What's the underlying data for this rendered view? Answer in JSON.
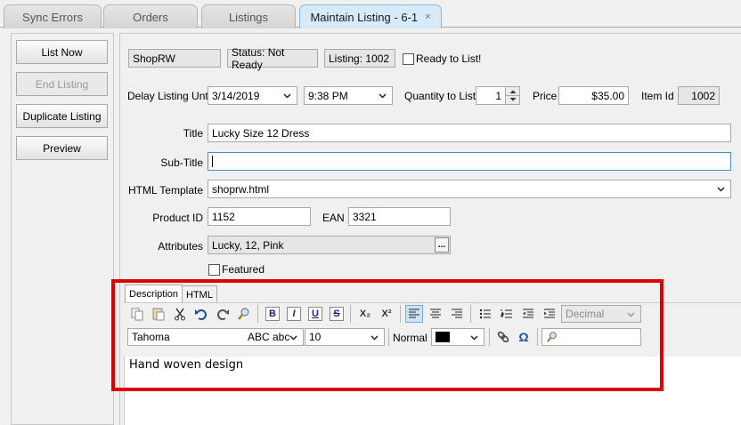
{
  "tabs": [
    {
      "label": "Sync Errors"
    },
    {
      "label": "Orders"
    },
    {
      "label": "Listings"
    },
    {
      "label": "Maintain Listing - 6-1",
      "close": "×"
    }
  ],
  "actions": {
    "list_now": "List Now",
    "end_listing": "End Listing",
    "duplicate_listing": "Duplicate Listing",
    "preview": "Preview"
  },
  "header": {
    "store": "ShopRW",
    "status": "Status: Not Ready",
    "listing": "Listing: 1002",
    "ready_label": "Ready to List!"
  },
  "schedule": {
    "delay_label": "Delay Listing Until",
    "date": "3/14/2019",
    "time": "9:38 PM",
    "qty_label": "Quantity to List",
    "qty": "1",
    "price_label": "Price",
    "price": "$35.00",
    "itemid_label": "Item Id",
    "itemid": "1002"
  },
  "form": {
    "title_label": "Title",
    "title": "Lucky Size 12 Dress",
    "subtitle_label": "Sub-Title",
    "subtitle": "",
    "template_label": "HTML Template",
    "template": "shoprw.html",
    "product_id_label": "Product ID",
    "product_id": "1152",
    "ean_label": "EAN",
    "ean": "3321",
    "attributes_label": "Attributes",
    "attributes": "Lucky, 12, Pink",
    "attributes_btn": "...",
    "featured_label": "Featured"
  },
  "editor": {
    "tab_description": "Description",
    "tab_html": "HTML",
    "list_style": "Decimal",
    "font": "Tahoma",
    "font_sample": "ABC abc",
    "size": "10",
    "style": "Normal",
    "content": "Hand woven design",
    "b": "B",
    "i": "I",
    "u": "U",
    "s": "S",
    "sub": "X₂",
    "sup": "X²",
    "omega": "Ω"
  }
}
